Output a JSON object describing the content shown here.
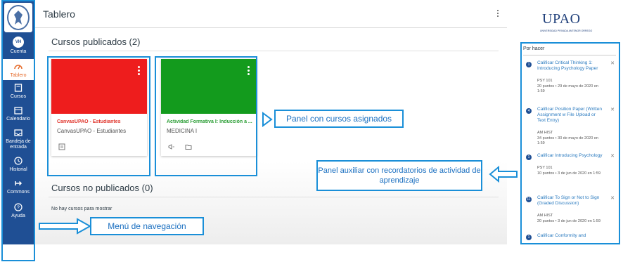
{
  "nav": {
    "items": [
      {
        "label": "Cuenta",
        "avatar": "VH",
        "icon": "avatar-icon"
      },
      {
        "label": "Tablero",
        "icon": "dashboard-icon"
      },
      {
        "label": "Cursos",
        "icon": "book-icon"
      },
      {
        "label": "Calendario",
        "icon": "calendar-icon"
      },
      {
        "label": "Bandeja de entrada",
        "icon": "inbox-icon"
      },
      {
        "label": "Historial",
        "icon": "clock-icon"
      },
      {
        "label": "Commons",
        "icon": "commons-icon"
      },
      {
        "label": "Ayuda",
        "icon": "help-icon"
      }
    ]
  },
  "header": {
    "title": "Tablero"
  },
  "published": {
    "title": "Cursos publicados (2)",
    "cards": [
      {
        "name": "CanvasUPAO - Estudiantes",
        "sub": "CanvasUPAO - Estudiantes",
        "color": "#ee1d1d",
        "name_color": "#e0342b"
      },
      {
        "name": "Actividad Formativa I: Inducción a ...",
        "sub": "MEDICINA I",
        "color": "#139b1d",
        "name_color": "#2a9d34"
      }
    ]
  },
  "unpublished": {
    "title": "Cursos no publicados (0)",
    "empty": "No hay cursos para mostrar"
  },
  "logo": {
    "name": "UPAO",
    "tagline": "UNIVERSIDAD PRIVADA ANTENOR ORREGO"
  },
  "todo": {
    "heading": "Por hacer",
    "items": [
      {
        "badge": "1",
        "title": "Calificar Critical Thinking 1: Introducing Psychology Paper",
        "course": "PSY 101",
        "meta": "20 puntos • 29 de mayo de 2020 en 1:59"
      },
      {
        "badge": "4",
        "title": "Calificar Position Paper (Written Assignment w File Upload or Text Entry)",
        "course": "AM HIST",
        "meta": "34 puntos • 30 de mayo de 2020 en 1:59"
      },
      {
        "badge": "1",
        "title": "Calificar Introducing Psychology",
        "course": "PSY 101",
        "meta": "10 puntos • 3 de jun de 2020 en 1:59"
      },
      {
        "badge": "11",
        "title": "Calificar To Sign or Not to Sign (Graded Discussion)",
        "course": "AM HIST",
        "meta": "20 puntos • 3 de jun de 2020 en 1:59"
      },
      {
        "badge": "1",
        "title": "Calificar Conformity and",
        "course": "",
        "meta": ""
      }
    ]
  },
  "annotations": {
    "courses": "Panel con cursos asignados",
    "aux": "Panel auxiliar con recordatorios de actividad de aprendizaje",
    "nav": "Menú de navegación"
  },
  "colors": {
    "nav": "#1f4f94",
    "annotation": "#1a8fd8",
    "link": "#2a7abf"
  }
}
